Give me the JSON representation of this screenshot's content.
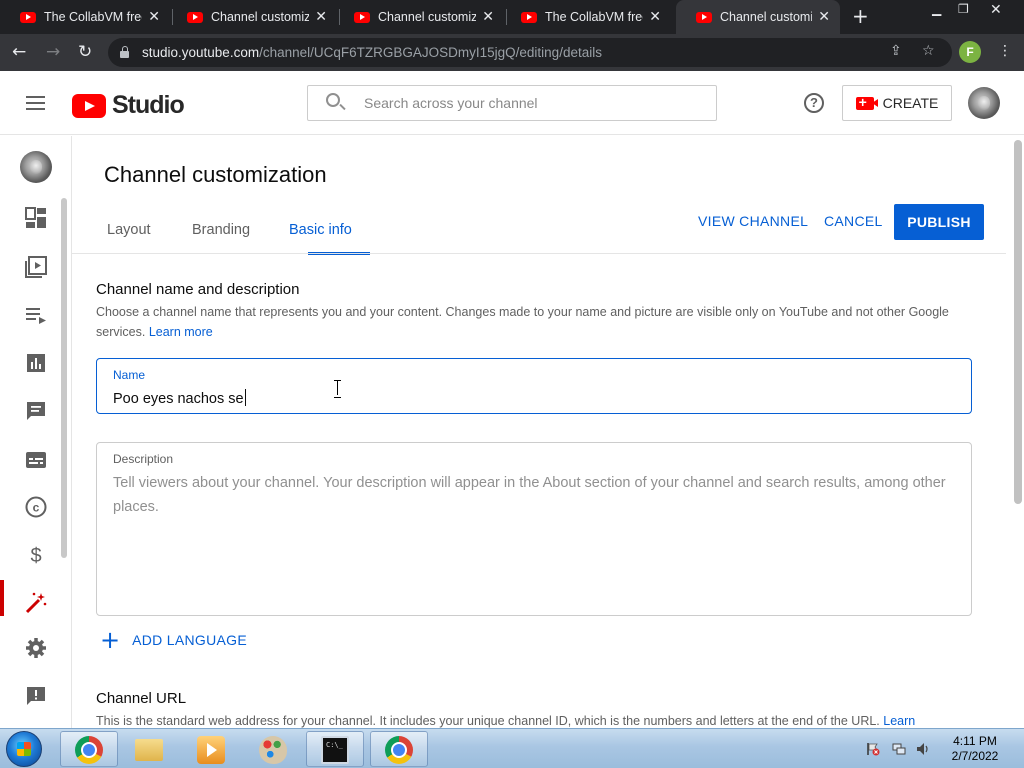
{
  "browser": {
    "tabs": [
      {
        "title": "The CollabVM free",
        "active": false
      },
      {
        "title": "Channel customiza",
        "active": false
      },
      {
        "title": "Channel customiza",
        "active": false
      },
      {
        "title": "The CollabVM free",
        "active": false
      },
      {
        "title": "Channel customiza",
        "active": true
      }
    ],
    "url_host": "studio.youtube.com",
    "url_path": "/channel/UCqF6TZRGBGAJOSDmyI15jgQ/editing/details",
    "profile_initial": "F"
  },
  "header": {
    "logo_text": "Studio",
    "search_placeholder": "Search across your channel",
    "create_label": "CREATE"
  },
  "page": {
    "title": "Channel customization",
    "tabs": [
      {
        "label": "Layout",
        "active": false
      },
      {
        "label": "Branding",
        "active": false
      },
      {
        "label": "Basic info",
        "active": true
      }
    ],
    "view_channel_label": "VIEW CHANNEL",
    "cancel_label": "CANCEL",
    "publish_label": "PUBLISH"
  },
  "name_section": {
    "title": "Channel name and description",
    "description": "Choose a channel name that represents you and your content. Changes made to your name and picture are visible only on YouTube and not other Google services.",
    "learn_more": "Learn more",
    "name_label": "Name",
    "name_value": "Poo eyes nachos se",
    "description_label": "Description",
    "description_placeholder": "Tell viewers about your channel. Your description will appear in the About section of your channel and search results, among other places.",
    "add_language_label": "ADD LANGUAGE"
  },
  "url_section": {
    "title": "Channel URL",
    "description": "This is the standard web address for your channel. It includes your unique channel ID, which is the numbers and letters at the end of the URL.",
    "learn_more": "Learn"
  },
  "taskbar": {
    "time": "4:11 PM",
    "date": "2/7/2022",
    "cmd_text": "C:\\_"
  },
  "colors": {
    "accent": "#065fd4",
    "brand_red": "#ff0000",
    "active_nav": "#cc0000"
  }
}
